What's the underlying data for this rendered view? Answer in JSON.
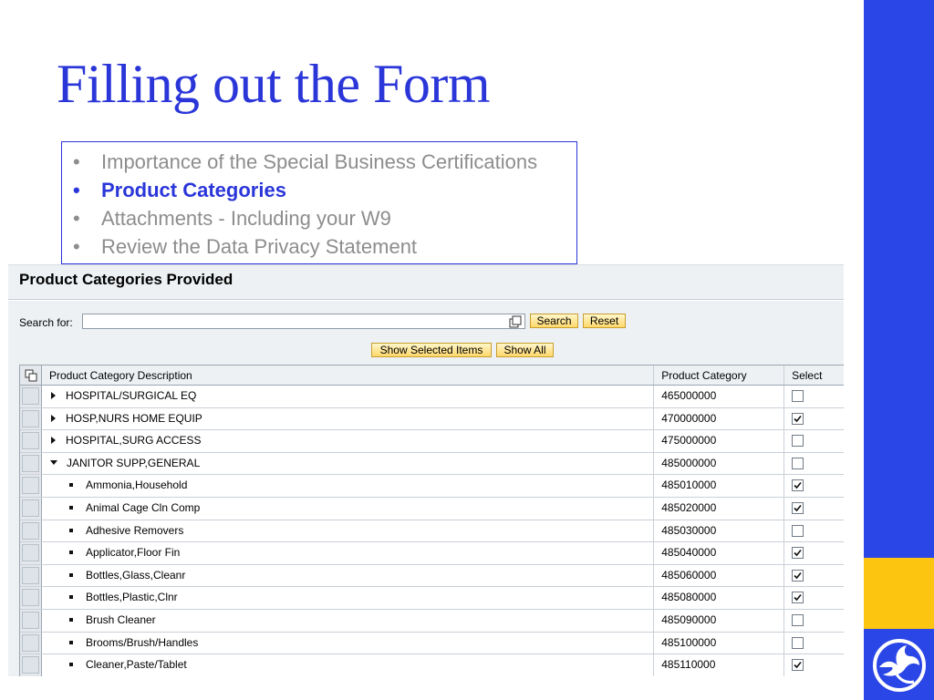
{
  "slide": {
    "title": "Filling out the Form",
    "agenda": [
      {
        "label": "Importance of the Special Business Certifications",
        "active": false
      },
      {
        "label": "Product Categories",
        "active": true
      },
      {
        "label": "Attachments - Including your W9",
        "active": false
      },
      {
        "label": "Review the Data Privacy Statement",
        "active": false
      }
    ],
    "colors": {
      "title": "#2b36d9",
      "band_blue": "#2b46e6",
      "band_yellow": "#fcc50f"
    },
    "logo": "phoenix-bird-logo"
  },
  "panel": {
    "title": "Product Categories Provided",
    "search_label": "Search for:",
    "search_value": "",
    "search_button": "Search",
    "reset_button": "Reset",
    "show_selected_button": "Show Selected Items",
    "show_all_button": "Show All"
  },
  "table": {
    "columns": [
      "Product Category Description",
      "Product Category",
      "Select"
    ],
    "rows": [
      {
        "description": "HOSPITAL/SURGICAL EQ",
        "category": "465000000",
        "selected": false,
        "level": "collapsed"
      },
      {
        "description": "HOSP,NURS HOME EQUIP",
        "category": "470000000",
        "selected": true,
        "level": "collapsed"
      },
      {
        "description": "HOSPITAL,SURG ACCESS",
        "category": "475000000",
        "selected": false,
        "level": "collapsed"
      },
      {
        "description": "JANITOR SUPP,GENERAL",
        "category": "485000000",
        "selected": false,
        "level": "expanded"
      },
      {
        "description": "Ammonia,Household",
        "category": "485010000",
        "selected": true,
        "level": "child"
      },
      {
        "description": "Animal Cage Cln Comp",
        "category": "485020000",
        "selected": true,
        "level": "child"
      },
      {
        "description": "Adhesive Removers",
        "category": "485030000",
        "selected": false,
        "level": "child"
      },
      {
        "description": "Applicator,Floor Fin",
        "category": "485040000",
        "selected": true,
        "level": "child"
      },
      {
        "description": "Bottles,Glass,Cleanr",
        "category": "485060000",
        "selected": true,
        "level": "child"
      },
      {
        "description": "Bottles,Plastic,Clnr",
        "category": "485080000",
        "selected": true,
        "level": "child"
      },
      {
        "description": "Brush Cleaner",
        "category": "485090000",
        "selected": false,
        "level": "child"
      },
      {
        "description": "Brooms/Brush/Handles",
        "category": "485100000",
        "selected": false,
        "level": "child"
      },
      {
        "description": "Cleaner,Paste/Tablet",
        "category": "485110000",
        "selected": true,
        "level": "child"
      }
    ]
  }
}
